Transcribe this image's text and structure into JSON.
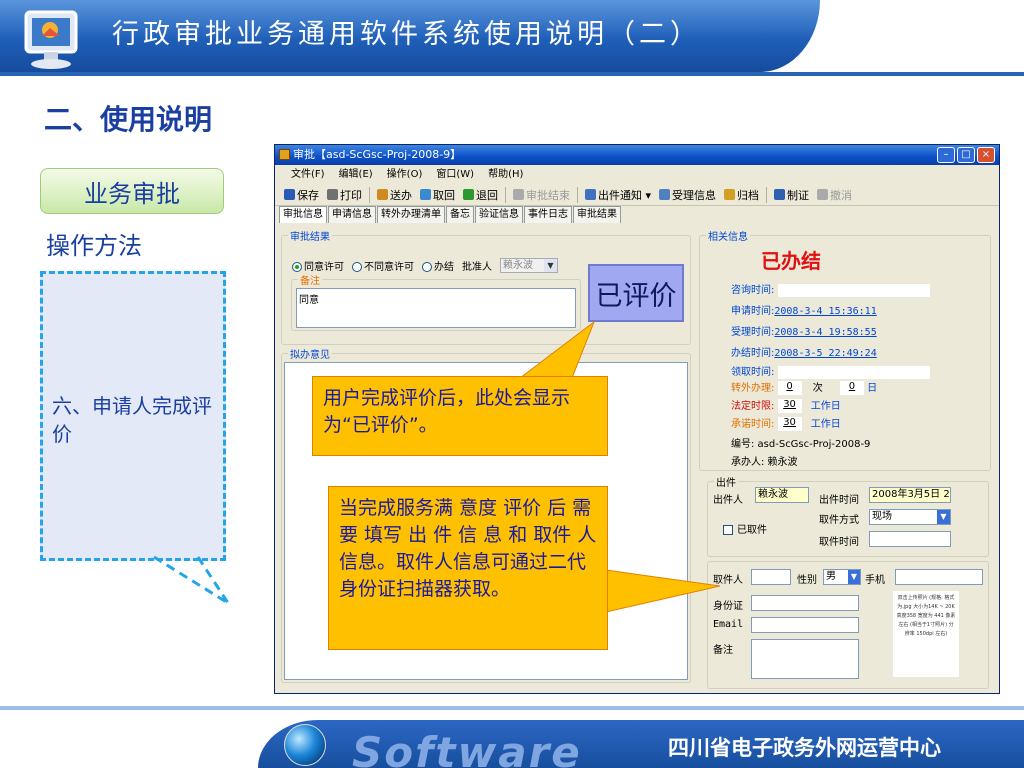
{
  "slide": {
    "title": "行政审批业务通用软件系统使用说明（二）",
    "section": "二、使用说明",
    "button": "业务审批",
    "method_label": "操作方法",
    "step_text": "六、申请人完成评价",
    "footer_brand": "Software",
    "footer_org": "四川省电子政务外网运营中心"
  },
  "window": {
    "title": "审批【asd-ScGsc-Proj-2008-9】",
    "menu": [
      "文件(F)",
      "编辑(E)",
      "操作(O)",
      "窗口(W)",
      "帮助(H)"
    ],
    "toolbar": [
      {
        "label": "保存",
        "icon": "save-icon",
        "color": "#2a5ab8",
        "disabled": false
      },
      {
        "label": "打印",
        "icon": "print-icon",
        "color": "#707070",
        "disabled": false
      },
      {
        "label": "送办",
        "icon": "send-icon",
        "color": "#d08a20",
        "disabled": false
      },
      {
        "label": "取回",
        "icon": "retrieve-icon",
        "color": "#3a8ad0",
        "disabled": false
      },
      {
        "label": "退回",
        "icon": "return-icon",
        "color": "#2a9a30",
        "disabled": false
      },
      {
        "label": "审批结束",
        "icon": "finish-icon",
        "color": "#aaaaaa",
        "disabled": true
      },
      {
        "label": "出件通知 ▾",
        "icon": "notify-icon",
        "color": "#4070c0",
        "disabled": false
      },
      {
        "label": "受理信息",
        "icon": "accept-info-icon",
        "color": "#5080c0",
        "disabled": false
      },
      {
        "label": "归档",
        "icon": "archive-icon",
        "color": "#d0a020",
        "disabled": false
      },
      {
        "label": "制证",
        "icon": "certificate-icon",
        "color": "#3060b0",
        "disabled": false
      },
      {
        "label": "撤消",
        "icon": "undo-icon",
        "color": "#aaaaaa",
        "disabled": true
      }
    ],
    "tabs": [
      "审批信息",
      "申请信息",
      "转外办理清单",
      "备忘",
      "验证信息",
      "事件日志",
      "审批结果"
    ],
    "approval": {
      "group_label": "审批结果",
      "options": [
        "同意许可",
        "不同意许可",
        "办结"
      ],
      "approver_label": "批准人",
      "approver_value": "赖永波",
      "remark_label": "备注",
      "remark_value": "同意",
      "opinion_label": "拟办意见",
      "rated_stamp": "已评价"
    },
    "related": {
      "group_label": "相关信息",
      "status": "已办结",
      "consult_label": "咨询时间:",
      "apply_label": "申请时间:",
      "apply_value": "2008-3-4 15:36:11",
      "accept_label": "受理时间:",
      "accept_value": "2008-3-4 19:58:55",
      "finish_label": "办结时间:",
      "finish_value": "2008-3-5 22:49:24",
      "pickup_label": "领取时间:",
      "transfer_label": "转外办理:",
      "transfer_count": "0",
      "transfer_count_unit": "次",
      "transfer_days": "0",
      "transfer_days_unit": "日",
      "legal_label": "法定时限:",
      "legal_value": "30",
      "legal_unit": "工作日",
      "promise_label": "承诺时间:",
      "promise_value": "30",
      "promise_unit": "工作日",
      "code_text": "编号: asd-ScGsc-Proj-2008-9",
      "handler_text": "承办人: 赖永波"
    },
    "delivery": {
      "group_label": "出件",
      "issuer_label": "出件人",
      "issuer_value": "赖永波",
      "issue_time_label": "出件时间",
      "issue_time_value": "2008年3月5日 2",
      "picked_label": "已取件",
      "method_label": "取件方式",
      "method_value": "现场",
      "pick_time_label": "取件时间",
      "picker_label": "取件人",
      "gender_label": "性别",
      "gender_value": "男",
      "phone_label": "手机",
      "id_label": "身份证",
      "email_label": "Email",
      "note_label": "备注",
      "photo_note": "双击上传照片 (规格: 格式为.jpg 大小为14K ~ 20K 高度358 宽度为 441 像素左右 (相当于1寸照片) 分辨率 150dpi 左右)"
    }
  },
  "callouts": {
    "rated": "用户完成评价后，此处会显示为“已评价”。",
    "pickup": "当完成服务满 意度 评价 后 需 要 填写 出 件 信 息 和 取件 人信息。取件人信息可通过二代身份证扫描器获取。"
  }
}
